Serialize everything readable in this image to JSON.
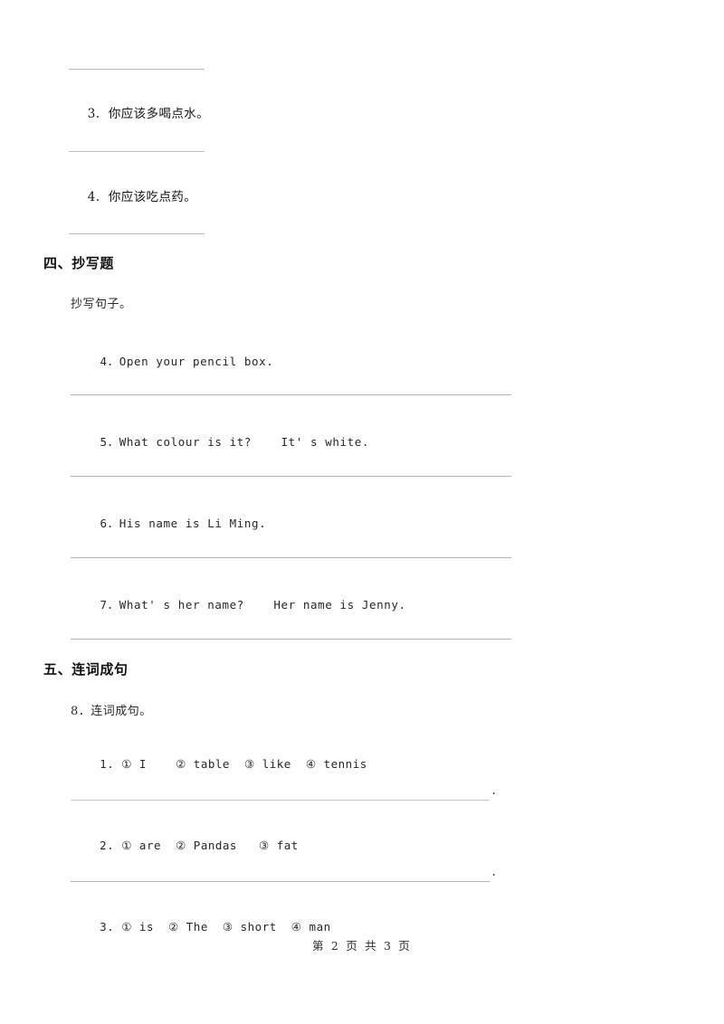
{
  "document": {
    "background_color": "#ffffff",
    "rule_color": "#b9b9bb",
    "text_color": "#1a1a1a"
  },
  "top_section": {
    "items": [
      {
        "number": "3.",
        "text": "你应该多喝点水。"
      },
      {
        "number": "4.",
        "text": "你应该吃点药。"
      }
    ]
  },
  "section_four": {
    "heading": "四、抄写题",
    "instruction": "抄写句子。",
    "items": [
      {
        "number": "4．",
        "text": "Open your pencil box."
      },
      {
        "number": "5．",
        "text": "What colour is it?    It' s white."
      },
      {
        "number": "6．",
        "text": "His name is Li Ming."
      },
      {
        "number": "7．",
        "text": "What' s her name?    Her name is Jenny."
      }
    ]
  },
  "section_five": {
    "heading": "五、连词成句",
    "instruction": "8．连词成句。",
    "items": [
      {
        "number": "1.",
        "text": "① I    ② table  ③ like  ④ tennis",
        "answer_end": "."
      },
      {
        "number": "2.",
        "text": "① are  ② Pandas   ③ fat",
        "answer_end": "."
      },
      {
        "number": "3.",
        "text": "① is  ② The  ③ short  ④ man",
        "answer_end": ""
      }
    ]
  },
  "footer": {
    "page_text": "第 2 页 共 3 页"
  }
}
